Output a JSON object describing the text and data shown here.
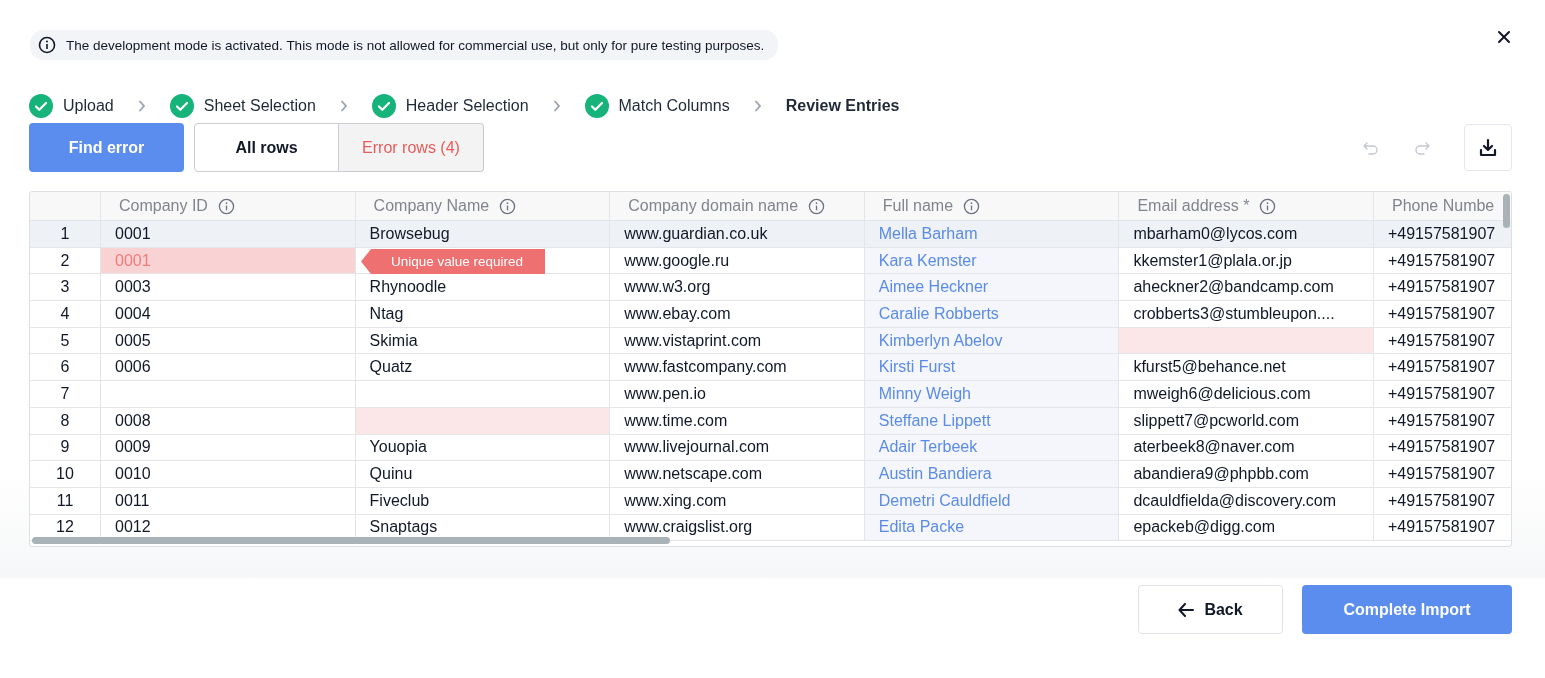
{
  "notice": "The development mode is activated. This mode is not allowed for commercial use, but only for pure testing purposes.",
  "steps": [
    {
      "label": "Upload",
      "done": true
    },
    {
      "label": "Sheet Selection",
      "done": true
    },
    {
      "label": "Header Selection",
      "done": true
    },
    {
      "label": "Match Columns",
      "done": true
    },
    {
      "label": "Review Entries",
      "done": false
    }
  ],
  "find_error": "Find error",
  "filters": [
    {
      "label": "All rows",
      "selected": true,
      "kind": "normal"
    },
    {
      "label": "Error rows (4)",
      "selected": false,
      "kind": "error"
    }
  ],
  "toolbar": {
    "undo_disabled": true,
    "redo_disabled": true
  },
  "table": {
    "columns": [
      {
        "label": "Company ID",
        "info": true,
        "link": false
      },
      {
        "label": "Company Name",
        "info": true,
        "link": false
      },
      {
        "label": "Company domain name",
        "info": true,
        "link": false
      },
      {
        "label": "Full name",
        "info": true,
        "link": true
      },
      {
        "label": "Email address *",
        "info": true,
        "link": false
      },
      {
        "label": "Phone Numbe",
        "info": false,
        "link": false
      }
    ],
    "rows": [
      {
        "num": "1",
        "selected": true,
        "cells": [
          {
            "text": "0001"
          },
          {
            "text": "Browsebug"
          },
          {
            "text": "www.guardian.co.uk"
          },
          {
            "text": "Mella Barham"
          },
          {
            "text": "mbarham0@lycos.com"
          },
          {
            "text": "+49157581907"
          }
        ]
      },
      {
        "num": "2",
        "selected": false,
        "cells": [
          {
            "text": "0001",
            "error": true,
            "focused": true
          },
          {},
          {
            "text": "www.google.ru"
          },
          {
            "text": "Kara Kemster"
          },
          {
            "text": "kkemster1@plala.or.jp"
          },
          {
            "text": "+49157581907"
          }
        ]
      },
      {
        "num": "3",
        "selected": false,
        "cells": [
          {
            "text": "0003"
          },
          {
            "text": "Rhynoodle"
          },
          {
            "text": "www.w3.org"
          },
          {
            "text": "Aimee Heckner"
          },
          {
            "text": "aheckner2@bandcamp.com"
          },
          {
            "text": "+49157581907"
          }
        ]
      },
      {
        "num": "4",
        "selected": false,
        "cells": [
          {
            "text": "0004"
          },
          {
            "text": "Ntag"
          },
          {
            "text": "www.ebay.com"
          },
          {
            "text": "Caralie Robberts"
          },
          {
            "text": "crobberts3@stumbleupon...."
          },
          {
            "text": "+49157581907"
          }
        ]
      },
      {
        "num": "5",
        "selected": false,
        "cells": [
          {
            "text": "0005"
          },
          {
            "text": "Skimia"
          },
          {
            "text": "www.vistaprint.com"
          },
          {
            "text": "Kimberlyn Abelov"
          },
          {
            "error": true
          },
          {
            "text": "+49157581907"
          }
        ]
      },
      {
        "num": "6",
        "selected": false,
        "cells": [
          {
            "text": "0006"
          },
          {
            "text": "Quatz"
          },
          {
            "text": "www.fastcompany.com"
          },
          {
            "text": "Kirsti Furst"
          },
          {
            "text": "kfurst5@behance.net"
          },
          {
            "text": "+49157581907"
          }
        ]
      },
      {
        "num": "7",
        "selected": false,
        "cells": [
          {},
          {},
          {
            "text": "www.pen.io"
          },
          {
            "text": "Minny Weigh"
          },
          {
            "text": "mweigh6@delicious.com"
          },
          {
            "text": "+49157581907"
          }
        ]
      },
      {
        "num": "8",
        "selected": false,
        "cells": [
          {
            "text": "0008"
          },
          {
            "error": true
          },
          {
            "text": "www.time.com"
          },
          {
            "text": "Steffane Lippett"
          },
          {
            "text": "slippett7@pcworld.com"
          },
          {
            "text": "+49157581907"
          }
        ]
      },
      {
        "num": "9",
        "selected": false,
        "cells": [
          {
            "text": "0009"
          },
          {
            "text": "Youopia"
          },
          {
            "text": "www.livejournal.com"
          },
          {
            "text": "Adair Terbeek"
          },
          {
            "text": "aterbeek8@naver.com"
          },
          {
            "text": "+49157581907"
          }
        ]
      },
      {
        "num": "10",
        "selected": false,
        "cells": [
          {
            "text": "0010"
          },
          {
            "text": "Quinu"
          },
          {
            "text": "www.netscape.com"
          },
          {
            "text": "Austin Bandiera"
          },
          {
            "text": "abandiera9@phpbb.com"
          },
          {
            "text": "+49157581907"
          }
        ]
      },
      {
        "num": "11",
        "selected": false,
        "cells": [
          {
            "text": "0011"
          },
          {
            "text": "Fiveclub"
          },
          {
            "text": "www.xing.com"
          },
          {
            "text": "Demetri Cauldfield"
          },
          {
            "text": "dcauldfielda@discovery.com"
          },
          {
            "text": "+49157581907"
          }
        ]
      },
      {
        "num": "12",
        "selected": false,
        "cells": [
          {
            "text": "0012"
          },
          {
            "text": "Snaptags"
          },
          {
            "text": "www.craigslist.org"
          },
          {
            "text": "Edita Packe"
          },
          {
            "text": "epackeb@digg.com"
          },
          {
            "text": "+49157581907"
          }
        ]
      }
    ]
  },
  "tooltip": "Unique value required",
  "back": "Back",
  "complete": "Complete Import"
}
